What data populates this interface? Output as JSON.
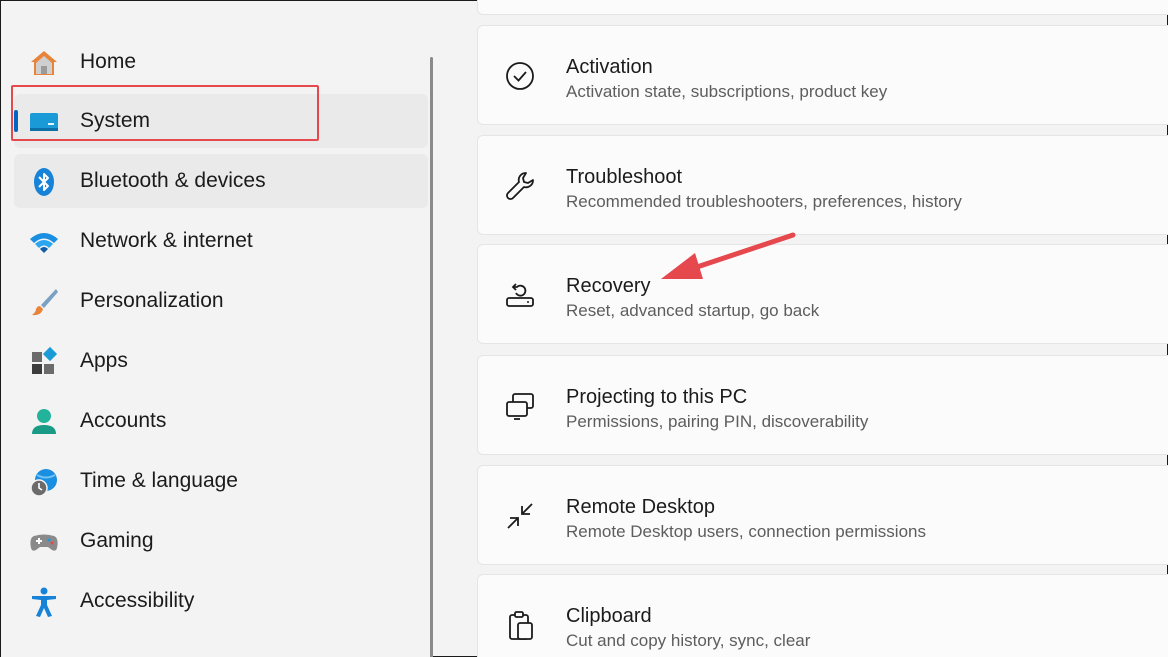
{
  "sidebar": {
    "items": [
      {
        "label": "Home",
        "icon": "home-icon"
      },
      {
        "label": "System",
        "icon": "monitor-icon",
        "selected": true
      },
      {
        "label": "Bluetooth & devices",
        "icon": "bluetooth-icon"
      },
      {
        "label": "Network & internet",
        "icon": "wifi-icon"
      },
      {
        "label": "Personalization",
        "icon": "brush-icon"
      },
      {
        "label": "Apps",
        "icon": "apps-icon"
      },
      {
        "label": "Accounts",
        "icon": "person-icon"
      },
      {
        "label": "Time & language",
        "icon": "globe-clock-icon"
      },
      {
        "label": "Gaming",
        "icon": "gamepad-icon"
      },
      {
        "label": "Accessibility",
        "icon": "accessibility-icon"
      }
    ]
  },
  "cards": [
    {
      "title": "Activation",
      "subtitle": "Activation state, subscriptions, product key",
      "icon": "check-circle-icon"
    },
    {
      "title": "Troubleshoot",
      "subtitle": "Recommended troubleshooters, preferences, history",
      "icon": "wrench-icon"
    },
    {
      "title": "Recovery",
      "subtitle": "Reset, advanced startup, go back",
      "icon": "recovery-icon"
    },
    {
      "title": "Projecting to this PC",
      "subtitle": "Permissions, pairing PIN, discoverability",
      "icon": "projecting-icon"
    },
    {
      "title": "Remote Desktop",
      "subtitle": "Remote Desktop users, connection permissions",
      "icon": "remote-desktop-icon"
    },
    {
      "title": "Clipboard",
      "subtitle": "Cut and copy history, sync, clear",
      "icon": "clipboard-icon"
    }
  ],
  "colors": {
    "accent": "#0067c0",
    "annotation": "#e5484d"
  }
}
